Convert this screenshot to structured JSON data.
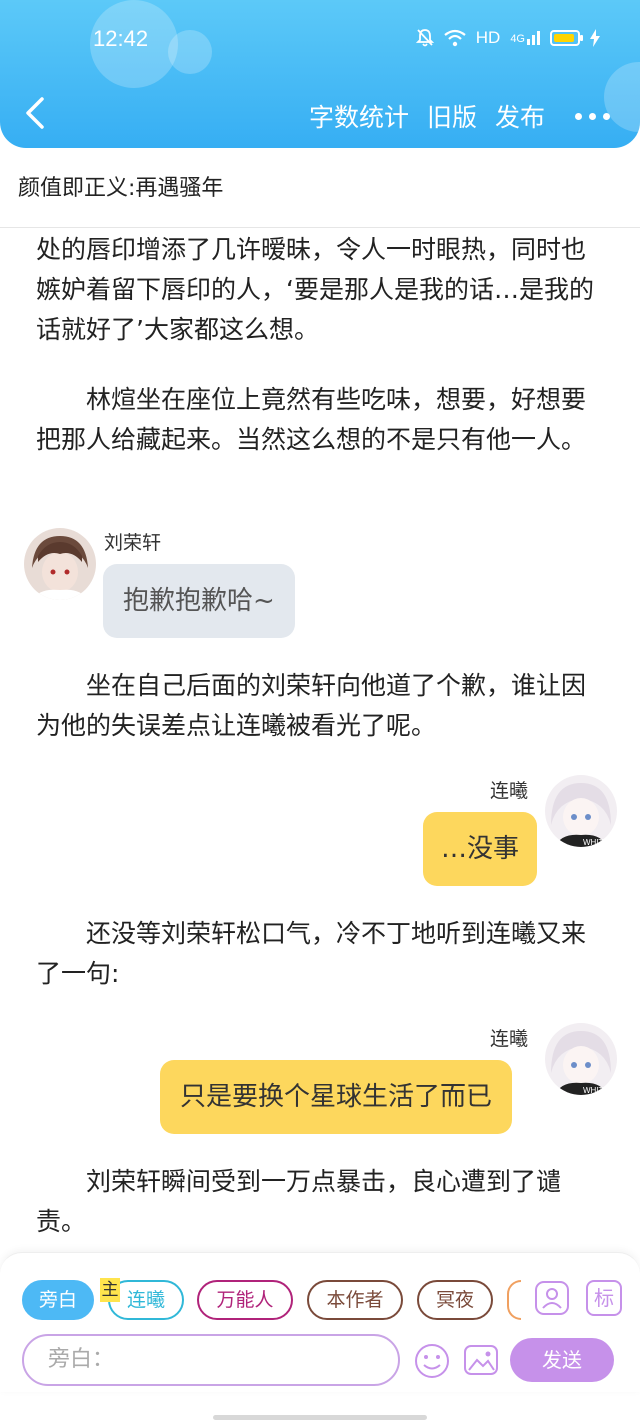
{
  "status_bar": {
    "time": "12:42",
    "network": "HD",
    "signal": "4G"
  },
  "toolbar": {
    "word_count": "字数统计",
    "old_version": "旧版",
    "publish": "发布"
  },
  "story_title": "颜值即正义:再遇骚年",
  "paragraphs": [
    "处的唇印增添了几许暧昧，令人一时眼热，同时也嫉妒着留下唇印的人，‘要是那人是我的话…是我的话就好了’大家都这么想。",
    "　　林煊坐在座位上竟然有些吃味，想要，好想要把那人给藏起来。当然这么想的不是只有他一人。",
    "　　坐在自己后面的刘荣轩向他道了个歉，谁让因为他的失误差点让连曦被看光了呢。",
    "　　还没等刘荣轩松口气，冷不丁地听到连曦又来了一句:",
    "　　刘荣轩瞬间受到一万点暴击，良心遭到了谴责。"
  ],
  "messages": [
    {
      "speaker": "刘荣轩",
      "text": "抱歉抱歉哈~",
      "side": "left"
    },
    {
      "speaker": "连曦",
      "text": "…没事",
      "side": "right"
    },
    {
      "speaker": "连曦",
      "text": "只是要换个星球生活了而已",
      "side": "right"
    }
  ],
  "roles": [
    {
      "label": "旁白",
      "color": "#4db9f5"
    },
    {
      "label": "连曦",
      "color": "#30b8d8",
      "badge": "主"
    },
    {
      "label": "万能人",
      "color": "#b0237a"
    },
    {
      "label": "本作者",
      "color": "#7a4a3a"
    },
    {
      "label": "冥夜",
      "color": "#7a4a3a"
    }
  ],
  "role_panel": {
    "tag_label": "标"
  },
  "composer": {
    "placeholder": "旁白：",
    "send_label": "发送"
  }
}
